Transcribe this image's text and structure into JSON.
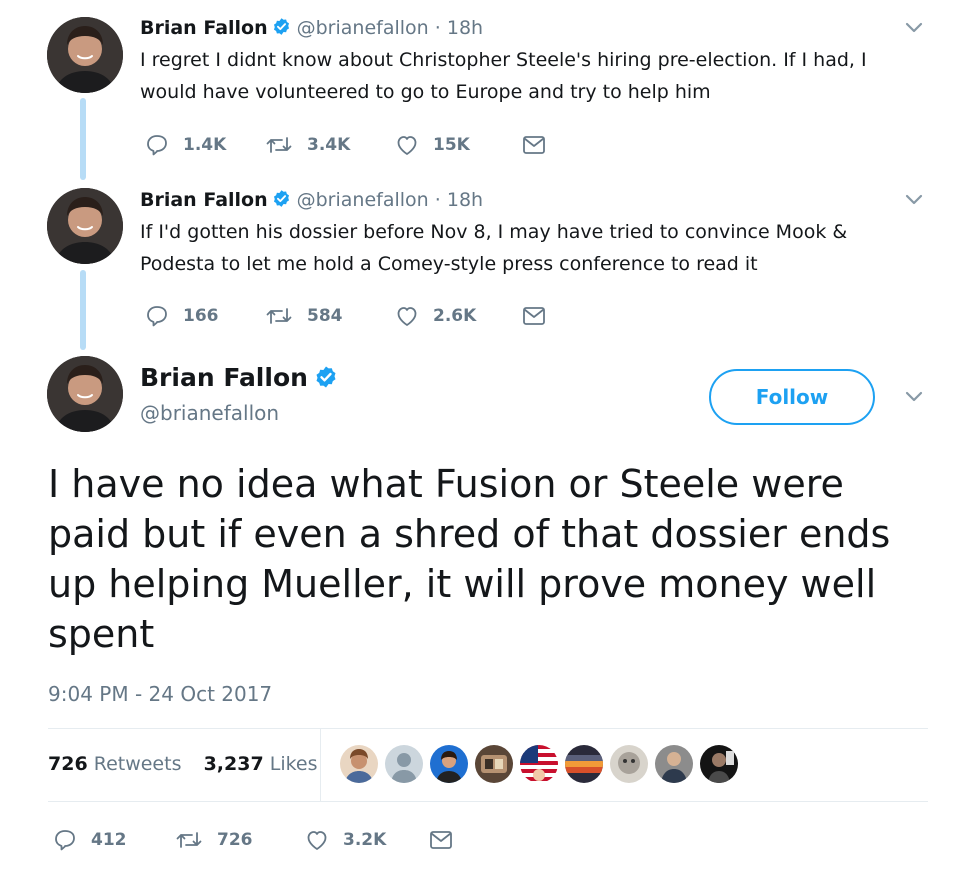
{
  "reply1": {
    "name": "Brian Fallon",
    "handle": "@brianefallon",
    "separator": "·",
    "time": "18h",
    "text": "I regret I didnt know about Christopher Steele's hiring pre-election. If I had, I would have volunteered to go to Europe and try to help him",
    "replies": "1.4K",
    "retweets": "3.4K",
    "likes": "15K"
  },
  "reply2": {
    "name": "Brian Fallon",
    "handle": "@brianefallon",
    "separator": "·",
    "time": "18h",
    "text": "If I'd gotten his dossier before Nov 8, I may have tried to convince Mook & Podesta to let me hold a Comey-style press conference to read it",
    "replies": "166",
    "retweets": "584",
    "likes": "2.6K"
  },
  "main": {
    "name": "Brian Fallon",
    "handle": "@brianefallon",
    "follow_label": "Follow",
    "text": "I have no idea what Fusion or Steele were paid but if even a shred of that dossier ends up helping Mueller, it will prove money well spent",
    "timestamp": "9:04 PM - 24 Oct 2017",
    "retweet_count": "726",
    "retweet_label": "Retweets",
    "like_count": "3,237",
    "like_label": "Likes",
    "replies": "412",
    "retweets": "726",
    "likes": "3.2K"
  },
  "colors": {
    "accent": "#1da1f2",
    "muted": "#657786",
    "thread_line": "#b7dcf6",
    "text": "#14171a"
  },
  "icons": {
    "verified": "verified-badge-icon",
    "reply": "reply-icon",
    "retweet": "retweet-icon",
    "like": "heart-icon",
    "message": "envelope-icon",
    "more": "chevron-down-icon"
  }
}
